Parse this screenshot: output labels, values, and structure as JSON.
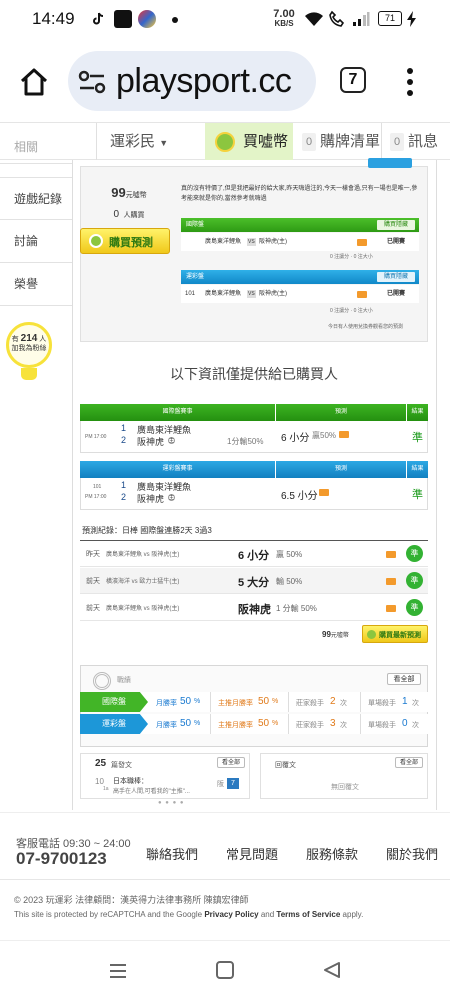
{
  "status": {
    "time": "14:49",
    "net_speed": "7.00",
    "net_unit": "KB/S",
    "battery": "71"
  },
  "browser": {
    "url": "playsport.cc",
    "tab_count": "7"
  },
  "nav": {
    "left": "運彩民",
    "buy": "買噓幣",
    "cart_count": "0",
    "cart": "購牌清單",
    "msg_count": "0",
    "messages": "訊息"
  },
  "sidebar": {
    "items": [
      "遊戲紀錄",
      "討論",
      "榮譽"
    ],
    "partial_item": "相關",
    "bulb_prefix": "有",
    "bulb_count": "214",
    "bulb_suffix": "人",
    "bulb_line2": "加我為粉絲"
  },
  "buy_panel": {
    "price": "99",
    "price_unit": "元噓幣",
    "buyers": "0",
    "buyers_unit": "人購買",
    "buy_button": "購買預測",
    "desc": "真的沒有特價了,但是我把最好的給大家,昨天嗨過注的,今天一樣會過,只有一場也是唯一,參考能來就是你的,當然參考就嗨過",
    "intl": {
      "label": "國際盤",
      "action": "購買隱藏",
      "team_a": "廣島東洋鯉魚",
      "vs": "VS",
      "team_b": "阪神虎(主)",
      "status": "已開賽",
      "note": "0 注讓分 · 0 注大小"
    },
    "lottery": {
      "label": "運彩盤",
      "action": "購買隱藏",
      "game_no": "101",
      "team_a": "廣島東洋鯉魚",
      "vs": "VS",
      "team_b": "阪神虎(主)",
      "status": "已開賽",
      "note": "0 注讓分 · 0 注大小"
    },
    "footnote": "今日有人使用兌換券觀看您的預測"
  },
  "buyer_notice": "以下資訊僅提供給已購買人",
  "intl_table": {
    "col1": "國際盤賽事",
    "col2": "預測",
    "col3": "結果",
    "time": "PM 17:00",
    "n1": "1",
    "team1": "廣島東洋鯉魚",
    "n2": "2",
    "team2": "阪神虎",
    "home": "主",
    "line": "1分輸50%",
    "pick": "6 小分",
    "rate": "贏50%",
    "result": "準"
  },
  "lottery_table": {
    "col1": "運彩盤賽事",
    "col2": "預測",
    "col3": "結果",
    "game_no": "101",
    "time": "PM 17:00",
    "n1": "1",
    "team1": "廣島東洋鯉魚",
    "n2": "2",
    "team2": "阪神虎",
    "home": "主",
    "pick": "6.5 小分",
    "result": "準"
  },
  "record": {
    "title": "預測紀錄：日棒 國際盤連勝2天 3過3",
    "rows": [
      {
        "day": "昨天",
        "match": "廣島東洋鯉魚 vs 阪神虎(主)",
        "pick": "6 小分",
        "detail": "贏 50%",
        "res": "準"
      },
      {
        "day": "前天",
        "match": "橫濱海洋 vs 歐力士猛牛(主)",
        "pick": "5 大分",
        "detail": "輸 50%",
        "res": "準"
      },
      {
        "day": "前天",
        "match": "廣島東洋鯉魚 vs 阪神虎(主)",
        "pick": "阪神虎",
        "detail": "1 分輸 50%",
        "res": "準"
      }
    ],
    "price": "99",
    "price_unit": "元噓幣",
    "buy_latest": "購買最新預測"
  },
  "stats": {
    "title": "戰績",
    "see_all": "看全部",
    "intl": {
      "label": "國際盤",
      "win_month": "月勝率",
      "win_month_val": "50",
      "pct": "%",
      "main_win": "主推月勝率",
      "main_win_val": "50",
      "pct2": "%",
      "streak_label": "莊家殺手",
      "streak_val": "2",
      "unit": "次",
      "killer_label": "單場殺手",
      "killer_val": "1",
      "unit2": "次"
    },
    "lottery": {
      "label": "運彩盤",
      "win_month": "月勝率",
      "win_month_val": "50",
      "pct": "%",
      "main_win": "主推月勝率",
      "main_win_val": "50",
      "pct2": "%",
      "streak_label": "莊家殺手",
      "streak_val": "3",
      "unit": "次",
      "killer_label": "單場殺手",
      "killer_val": "0",
      "unit2": "次"
    }
  },
  "posts": {
    "count": "25",
    "label": "篇發文",
    "see_all": "看全部",
    "item_num": "10",
    "item_tag": "1a",
    "item_title": "日本職棒：",
    "item_sub": "高手在人間,可看我的\"主推\"...",
    "item_badge": "7",
    "replies_label": "回覆文",
    "replies_see_all": "看全部",
    "no_replies": "無回覆文"
  },
  "footer": {
    "phone_label": "客服電話 09:30 ~ 24:00",
    "phone": "07-9700123",
    "links": [
      "聯絡我們",
      "常見問題",
      "服務條款",
      "關於我們"
    ],
    "copyright": "© 2023 玩運彩 法律顧問：漢英得力法律事務所 陳鎮宏律師",
    "recaptcha_pre": "This site is protected by reCAPTCHA and the Google",
    "privacy": "Privacy Policy",
    "and": "and",
    "terms": "Terms of Service",
    "apply": "apply."
  }
}
